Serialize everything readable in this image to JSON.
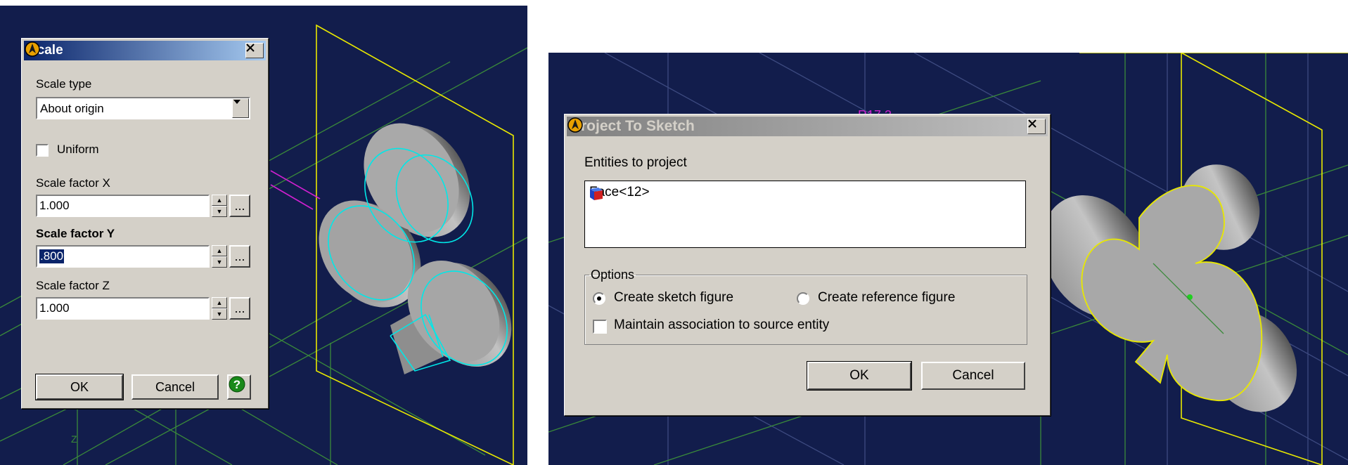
{
  "scale_dialog": {
    "title": "Scale",
    "scale_type_label": "Scale type",
    "scale_type_value": "About origin",
    "uniform_label": "Uniform",
    "uniform_checked": false,
    "x_label": "Scale factor X",
    "x_value": "1.000",
    "y_label": "Scale factor Y",
    "y_value": ".800",
    "z_label": "Scale factor Z",
    "z_value": "1.000",
    "ellipsis": "...",
    "ok_label": "OK",
    "cancel_label": "Cancel",
    "help_icon": "help-icon",
    "help_glyph": "?"
  },
  "project_dialog": {
    "title": "Project To Sketch",
    "entities_label": "Entities to project",
    "entities": [
      {
        "icon": "face-icon",
        "label": "Face<12>"
      }
    ],
    "options_label": "Options",
    "radio_sketch_label": "Create sketch figure",
    "radio_reference_label": "Create reference figure",
    "selected_radio": "sketch",
    "maintain_label": "Maintain association to source entity",
    "maintain_checked": false,
    "ok_label": "OK",
    "cancel_label": "Cancel"
  },
  "viewport": {
    "axis_label": "Z",
    "dimension_text": "R17.3",
    "background_color": "#121d4c",
    "grid_color": "#3a8a3a",
    "wire_color": "#e8e800",
    "highlight_color": "#00e8e8",
    "accent_color": "#d020d0"
  },
  "colors": {
    "dialog_face": "#d4d0c8",
    "active_title_start": "#0a246a",
    "active_title_end": "#a6caf0",
    "inactive_title_start": "#808080",
    "inactive_title_end": "#c0c0c0"
  }
}
